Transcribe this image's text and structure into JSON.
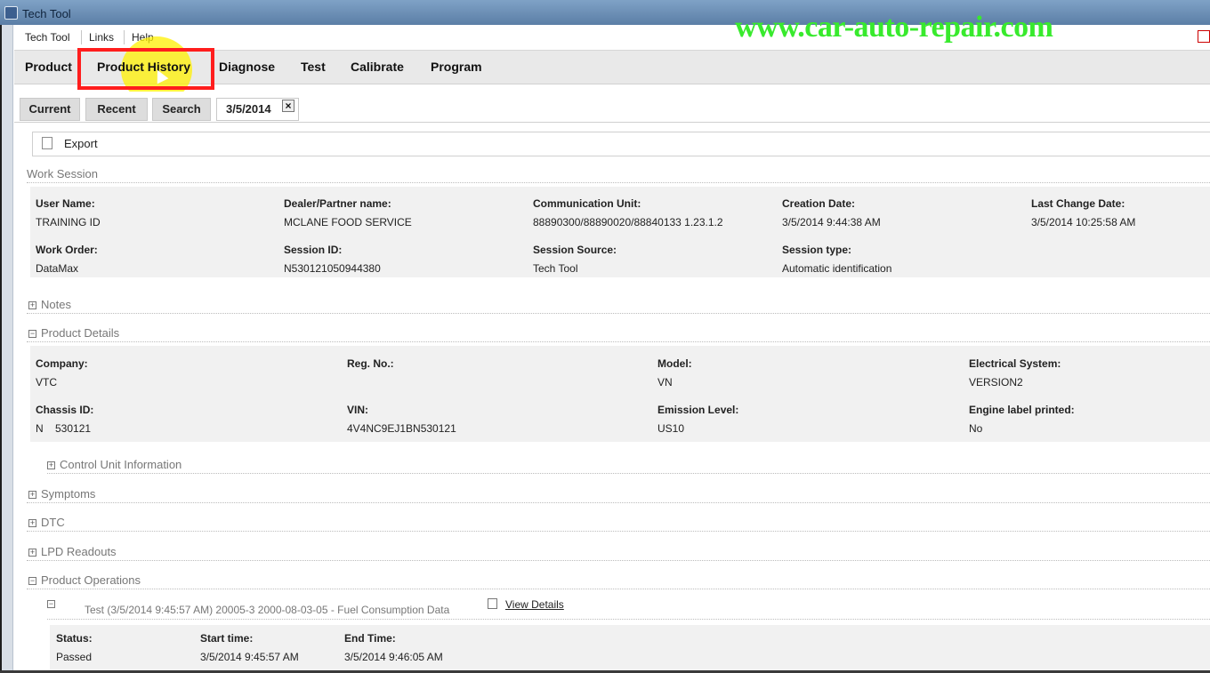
{
  "window": {
    "title": "Tech Tool"
  },
  "watermark": "www.car-auto-repair.com",
  "menu": {
    "items": [
      "Tech Tool",
      "Links",
      "Help"
    ]
  },
  "nav": {
    "items": [
      "Product",
      "Product History",
      "Diagnose",
      "Test",
      "Calibrate",
      "Program"
    ]
  },
  "tabs": {
    "items": [
      "Current",
      "Recent",
      "Search",
      "3/5/2014"
    ],
    "active_index": 3
  },
  "toolbar": {
    "export": "Export"
  },
  "work_session": {
    "title": "Work Session",
    "fields": [
      {
        "label": "User Name:",
        "value": "TRAINING ID"
      },
      {
        "label": "Dealer/Partner name:",
        "value": "MCLANE FOOD SERVICE"
      },
      {
        "label": "Communication Unit:",
        "value": "88890300/88890020/88840133 1.23.1.2"
      },
      {
        "label": "Creation Date:",
        "value": "3/5/2014 9:44:38 AM"
      },
      {
        "label": "Last Change Date:",
        "value": "3/5/2014 10:25:58 AM"
      },
      {
        "label": "Work Order:",
        "value": "DataMax"
      },
      {
        "label": "Session ID:",
        "value": "N530121050944380"
      },
      {
        "label": "Session Source:",
        "value": "Tech Tool"
      },
      {
        "label": "Session type:",
        "value": "Automatic identification"
      }
    ]
  },
  "notes": {
    "title": "Notes"
  },
  "product_details": {
    "title": "Product Details",
    "fields": [
      {
        "label": "Company:",
        "value": "VTC"
      },
      {
        "label": "Reg. No.:",
        "value": ""
      },
      {
        "label": "Model:",
        "value": "VN"
      },
      {
        "label": "Electrical System:",
        "value": "VERSION2"
      },
      {
        "label": "Chassis ID:",
        "value": "N    530121"
      },
      {
        "label": "VIN:",
        "value": "4V4NC9EJ1BN530121"
      },
      {
        "label": "Emission Level:",
        "value": "US10"
      },
      {
        "label": "Engine label printed:",
        "value": "No"
      }
    ],
    "control_unit": "Control Unit Information"
  },
  "sections": {
    "symptoms": "Symptoms",
    "dtc": "DTC",
    "lpd": "LPD Readouts"
  },
  "product_operations": {
    "title": "Product Operations",
    "entry": "Test (3/5/2014 9:45:57 AM) 20005-3 2000-08-03-05 - Fuel Consumption Data",
    "view_details": "View Details",
    "fields": [
      {
        "label": "Status:",
        "value": "Passed"
      },
      {
        "label": "Start time:",
        "value": "3/5/2014 9:45:57 AM"
      },
      {
        "label": "End Time:",
        "value": "3/5/2014 9:46:05 AM"
      }
    ]
  }
}
